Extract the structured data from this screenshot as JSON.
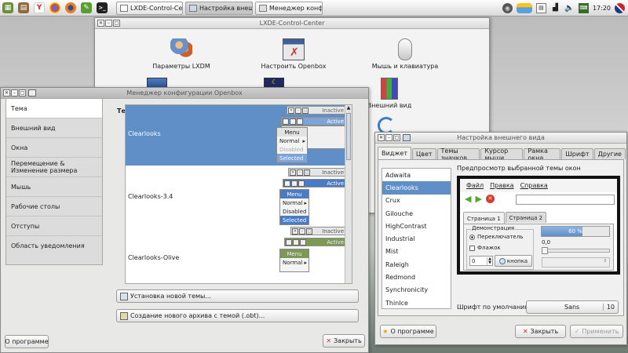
{
  "taskbar": {
    "tasks": [
      {
        "label": "LXDE-Control-Ce...",
        "active": false
      },
      {
        "label": "Настройка внеш...",
        "active": true
      },
      {
        "label": "Менеджер конф...",
        "active": false
      }
    ],
    "clock": "17:20",
    "quick_icons": [
      "menu-icon",
      "file-manager-icon",
      "yandex-icon",
      "chrome-icon",
      "firefox-icon",
      "lxde-icon",
      "terminal-icon"
    ],
    "tray_icons": [
      "disk-icon",
      "weather-icon",
      "clipboard-icon",
      "network-icon",
      "volume-icon",
      "keyboard-icon"
    ]
  },
  "control_center": {
    "title": "LXDE-Control-Center",
    "items": [
      {
        "label": "Параметры LXDM",
        "icon": "users-icon"
      },
      {
        "label": "Настроить Openbox",
        "icon": "openbox-icon"
      },
      {
        "label": "Мышь и клавиатура",
        "icon": "mouse-icon"
      },
      {
        "label": "Внешний вид",
        "icon": "appearance-icon"
      }
    ]
  },
  "openbox": {
    "title": "Менеджер конфигурации Openbox",
    "sidebar": [
      "Тема",
      "Внешний вид",
      "Окна",
      "Перемещение & Изменение размера",
      "Мышь",
      "Рабочие столы",
      "Отступы",
      "Область уведомления"
    ],
    "selected_index": 0,
    "section_title": "Тема",
    "themes": [
      {
        "name": "Clearlooks",
        "selected": true
      },
      {
        "name": "Clearlooks-3.4",
        "selected": false
      },
      {
        "name": "Clearlooks-Olive",
        "selected": false
      }
    ],
    "preview": {
      "inactive": "Inactive",
      "active": "Active",
      "menu": "Menu",
      "normal": "Normal",
      "disabled": "Disabled",
      "selected": "Selected"
    },
    "install_button": "Установка новой темы...",
    "archive_button": "Создание нового архива с темой (.obt)...",
    "about_button": "О программе",
    "close_button": "Закрыть"
  },
  "appearance": {
    "title": "Настройка внешнего вида",
    "tabs": [
      "Виджет",
      "Цвет",
      "Темы значков",
      "Курсор мыши",
      "Рамка окна",
      "Шрифт",
      "Другие"
    ],
    "widget_themes": [
      "Adwaita",
      "Clearlooks",
      "Crux",
      "Gilouche",
      "HighContrast",
      "Industrial",
      "Mist",
      "Raleigh",
      "Redmond",
      "Synchronicity",
      "ThinIce"
    ],
    "selected_theme_index": 1,
    "preview_label": "Предпросмотр выбранной темы окон",
    "preview_menu": [
      "Файл",
      "Правка",
      "Справка"
    ],
    "preview_tabs": [
      "Страница 1",
      "Страница 2"
    ],
    "demo_label": "Демонстрация",
    "radio_label": "Переключатель",
    "check_label": "Флажок",
    "progress_text": "60 %",
    "progress_value": 0.6,
    "slider_value": "0,0",
    "spin_value": "0",
    "button_label": "кнопка",
    "font_label": "Шрифт по умолчанию:",
    "font_name": "Sans",
    "font_size": "10",
    "about_button": "О программе",
    "close_button": "Закрыть",
    "apply_button": "Применить",
    "colors": {
      "selection": "#5f8fc6",
      "accent_green": "#57a52c",
      "accent_red": "#d83b2b"
    }
  }
}
